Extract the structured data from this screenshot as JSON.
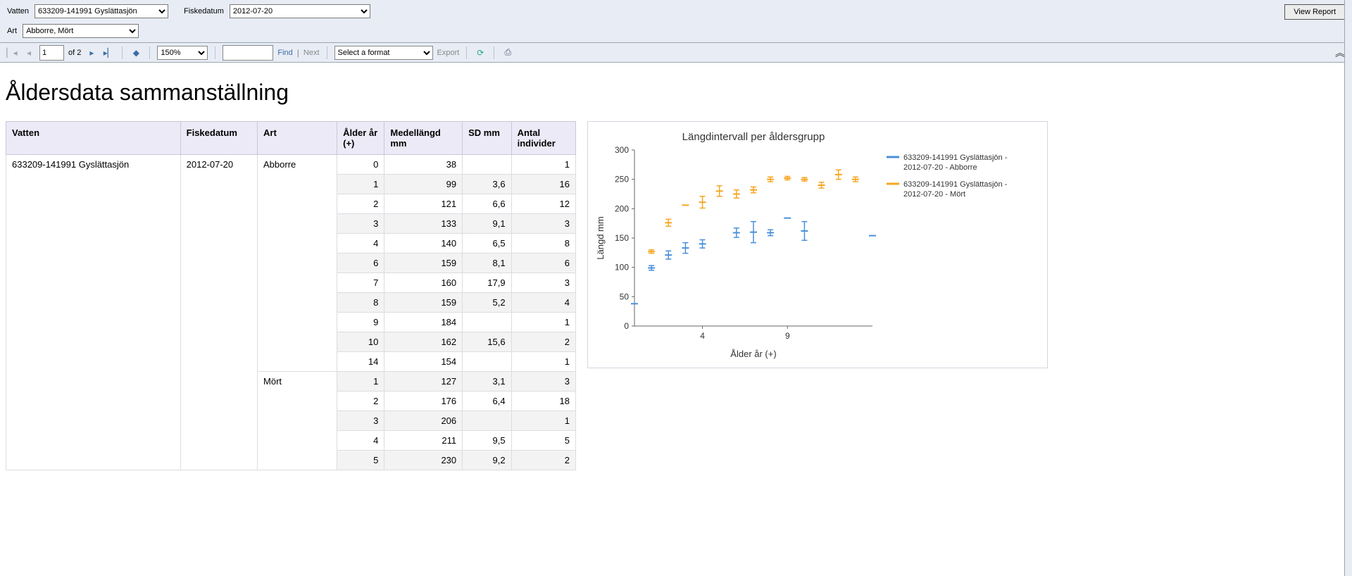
{
  "params": {
    "vatten_label": "Vatten",
    "vatten_value": "633209-141991 Gyslättasjön",
    "date_label": "Fiskedatum",
    "date_value": "2012-07-20",
    "art_label": "Art",
    "art_value": "Abborre, Mört",
    "view_report": "View Report"
  },
  "toolbar": {
    "page_value": "1",
    "of_text": "of 2",
    "zoom": "150%",
    "find": "Find",
    "next": "Next",
    "export_placeholder": "Select a format",
    "export_label": "Export"
  },
  "report": {
    "title": "Åldersdata sammanställning",
    "headers": {
      "vatten": "Vatten",
      "fiskedatum": "Fiskedatum",
      "art": "Art",
      "alder": "Ålder år (+)",
      "medel": "Medellängd mm",
      "sd": "SD mm",
      "antal": "Antal individer"
    },
    "vatten": "633209-141991 Gyslättasjön",
    "fiskedatum": "2012-07-20",
    "groups": [
      {
        "art": "Abborre",
        "rows": [
          {
            "alder": "0",
            "medel": "38",
            "sd": "",
            "antal": "1"
          },
          {
            "alder": "1",
            "medel": "99",
            "sd": "3,6",
            "antal": "16"
          },
          {
            "alder": "2",
            "medel": "121",
            "sd": "6,6",
            "antal": "12"
          },
          {
            "alder": "3",
            "medel": "133",
            "sd": "9,1",
            "antal": "3"
          },
          {
            "alder": "4",
            "medel": "140",
            "sd": "6,5",
            "antal": "8"
          },
          {
            "alder": "6",
            "medel": "159",
            "sd": "8,1",
            "antal": "6"
          },
          {
            "alder": "7",
            "medel": "160",
            "sd": "17,9",
            "antal": "3"
          },
          {
            "alder": "8",
            "medel": "159",
            "sd": "5,2",
            "antal": "4"
          },
          {
            "alder": "9",
            "medel": "184",
            "sd": "",
            "antal": "1"
          },
          {
            "alder": "10",
            "medel": "162",
            "sd": "15,6",
            "antal": "2"
          },
          {
            "alder": "14",
            "medel": "154",
            "sd": "",
            "antal": "1"
          }
        ]
      },
      {
        "art": "Mört",
        "rows": [
          {
            "alder": "1",
            "medel": "127",
            "sd": "3,1",
            "antal": "3"
          },
          {
            "alder": "2",
            "medel": "176",
            "sd": "6,4",
            "antal": "18"
          },
          {
            "alder": "3",
            "medel": "206",
            "sd": "",
            "antal": "1"
          },
          {
            "alder": "4",
            "medel": "211",
            "sd": "9,5",
            "antal": "5"
          },
          {
            "alder": "5",
            "medel": "230",
            "sd": "9,2",
            "antal": "2"
          }
        ]
      }
    ]
  },
  "chart_data": {
    "type": "scatter",
    "title": "Längdintervall per åldersgrupp",
    "xlabel": "Ålder år (+)",
    "ylabel": "Längd mm",
    "xlim": [
      0,
      14
    ],
    "ylim": [
      0,
      300
    ],
    "xticks": [
      4,
      9
    ],
    "yticks": [
      0,
      50,
      100,
      150,
      200,
      250,
      300
    ],
    "legend": [
      "633209-141991 Gyslättasjön - 2012-07-20 - Abborre",
      "633209-141991 Gyslättasjön - 2012-07-20 - Mört"
    ],
    "colors": {
      "Abborre": "#4a90d9",
      "Mört": "#f5a623"
    },
    "series": [
      {
        "name": "Abborre",
        "points": [
          {
            "x": 0,
            "y": 38,
            "err": 0
          },
          {
            "x": 1,
            "y": 99,
            "err": 4
          },
          {
            "x": 2,
            "y": 121,
            "err": 7
          },
          {
            "x": 3,
            "y": 133,
            "err": 9
          },
          {
            "x": 4,
            "y": 140,
            "err": 7
          },
          {
            "x": 6,
            "y": 159,
            "err": 8
          },
          {
            "x": 7,
            "y": 160,
            "err": 18
          },
          {
            "x": 8,
            "y": 159,
            "err": 5
          },
          {
            "x": 9,
            "y": 184,
            "err": 0
          },
          {
            "x": 10,
            "y": 162,
            "err": 16
          },
          {
            "x": 14,
            "y": 154,
            "err": 0
          }
        ]
      },
      {
        "name": "Mört",
        "points": [
          {
            "x": 1,
            "y": 127,
            "err": 3
          },
          {
            "x": 2,
            "y": 176,
            "err": 6
          },
          {
            "x": 3,
            "y": 206,
            "err": 0
          },
          {
            "x": 4,
            "y": 211,
            "err": 10
          },
          {
            "x": 5,
            "y": 230,
            "err": 9
          },
          {
            "x": 6,
            "y": 225,
            "err": 7
          },
          {
            "x": 7,
            "y": 232,
            "err": 5
          },
          {
            "x": 8,
            "y": 250,
            "err": 4
          },
          {
            "x": 9,
            "y": 252,
            "err": 3
          },
          {
            "x": 10,
            "y": 250,
            "err": 3
          },
          {
            "x": 11,
            "y": 240,
            "err": 5
          },
          {
            "x": 12,
            "y": 258,
            "err": 8
          },
          {
            "x": 13,
            "y": 250,
            "err": 4
          }
        ]
      }
    ]
  }
}
